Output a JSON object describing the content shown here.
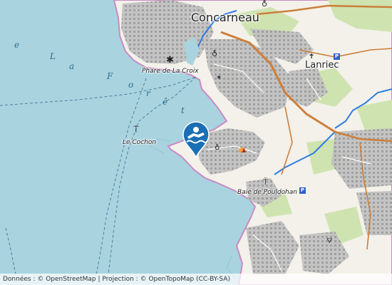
{
  "map": {
    "place_labels": {
      "concarneau": "Concarneau",
      "lanriec": "Lanriec",
      "phare": "Phare de La Croix",
      "le_cochon": "Le Cochon",
      "baie": "Baie de Pouldohan"
    },
    "sea_label_letters": [
      "e",
      "L",
      "a",
      "F",
      "o",
      "r",
      "ê",
      "t"
    ],
    "marker": {
      "icon": "swimming-icon",
      "color": "#1a6fb5"
    },
    "parking_glyph": "P",
    "colors": {
      "sea": "#a9d3df",
      "land": "#f3f1ea",
      "urban": "#b7b7b7",
      "road": "#cc7e3a",
      "river": "#2f7de1",
      "forest": "#cfe3b0",
      "shore": "#c98ac4"
    }
  },
  "attribution": {
    "text": "Données : © OpenStreetMap | Projection : © OpenTopoMap (CC-BY-SA)"
  }
}
